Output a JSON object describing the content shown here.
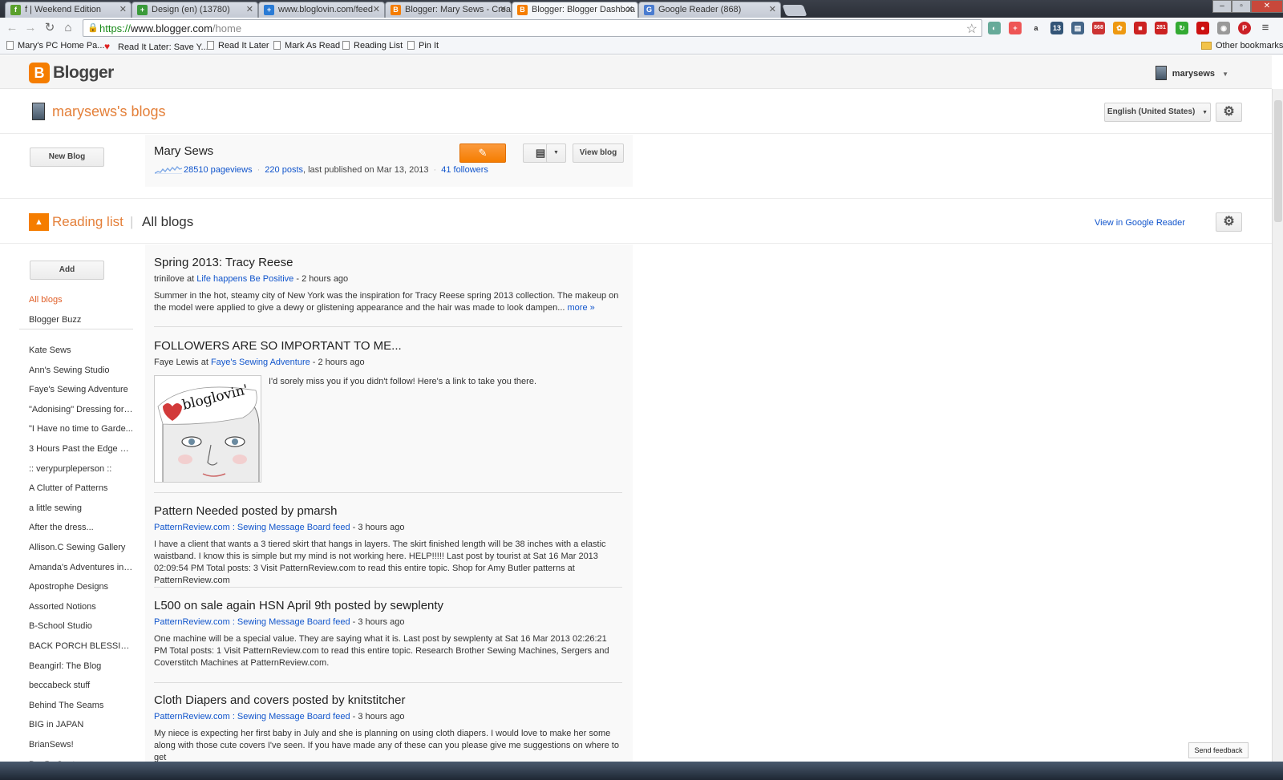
{
  "browser": {
    "tabs": [
      {
        "title": "f | Weekend Edition",
        "icon_color": "#5aa02c",
        "icon_char": "f"
      },
      {
        "title": "Design (en) (13780)",
        "icon_color": "#3a9a3a",
        "icon_char": "+"
      },
      {
        "title": "www.bloglovin.com/feed",
        "icon_color": "#2a7bd5",
        "icon_char": "+"
      },
      {
        "title": "Blogger: Mary Sews - Crea",
        "icon_color": "#f57d00",
        "icon_char": "B"
      },
      {
        "title": "Blogger: Blogger Dashboa",
        "icon_color": "#f57d00",
        "icon_char": "B"
      },
      {
        "title": "Google Reader (868)",
        "icon_color": "#4a7cd0",
        "icon_char": "G"
      }
    ],
    "url_scheme": "https://",
    "url_host": "www.blogger.com",
    "url_path": "/home",
    "bookmarks": [
      "Mary's PC Home Pa...",
      "Read It Later: Save Y...",
      "Read It Later",
      "Mark As Read",
      "Reading List",
      "Pin It"
    ],
    "other_bookmarks": "Other bookmarks",
    "extension_badges": {
      "dash": "13",
      "mail_count": "868",
      "gmail_count": "281"
    }
  },
  "header": {
    "logo_text": "Blogger",
    "username": "marysews"
  },
  "blogs_section": {
    "title": "marysews's blogs",
    "language": "English (United States)",
    "new_blog_label": "New Blog",
    "blog": {
      "name": "Mary Sews",
      "pageviews": "28510 pageviews",
      "posts": "220 posts",
      "published": ", last published on Mar 13, 2013",
      "followers": "41 followers",
      "view_blog_label": "View blog"
    }
  },
  "reading_list": {
    "title": "Reading list",
    "subtitle": "All blogs",
    "view_in_reader": "View in Google Reader",
    "add_label": "Add",
    "filters": [
      "All blogs",
      "Blogger Buzz"
    ],
    "blogs": [
      "Kate Sews",
      "Ann's Sewing Studio",
      "Faye's Sewing Adventure",
      "\"Adonising\" Dressing for ...",
      "\"I Have no time to Garde...",
      "3 Hours Past the Edge of...",
      ":: verypurpleperson ::",
      "A Clutter of Patterns",
      "a little sewing",
      "After the dress...",
      "Allison.C Sewing Gallery",
      "Amanda's Adventures in ...",
      "Apostrophe Designs",
      "Assorted Notions",
      "B-School Studio",
      "BACK PORCH BLESSIN...",
      "Beangirl: The Blog",
      "beccabeck stuff",
      "Behind The Seams",
      "BIG in JAPAN",
      "BrianSews!",
      "Byrdie Couture"
    ]
  },
  "posts": [
    {
      "title": "Spring 2013: Tracy Reese",
      "author": "trinilove",
      "at": " at ",
      "source": "Life happens Be Positive",
      "time": " - 2 hours ago",
      "body": "Summer in the hot, steamy city of New York was the inspiration for Tracy Reese spring 2013 collection. The makeup on the model were applied to give a dewy or glistening appearance and the hair was made to look dampen...",
      "more": "more »"
    },
    {
      "title": "FOLLOWERS ARE SO IMPORTANT TO ME...",
      "author": "Faye Lewis",
      "at": " at ",
      "source": "Faye's Sewing Adventure",
      "time": " - 2 hours ago",
      "body": "I'd sorely miss you if you didn't follow! Here's a link to take you there.",
      "image_text": "bloglovin'"
    },
    {
      "title": "Pattern Needed posted by pmarsh",
      "source": "PatternReview.com : Sewing Message Board feed",
      "time": " - 3 hours ago",
      "body": "I have a client that wants a 3 tiered skirt that hangs in layers. The skirt finished length will be 38 inches with a elastic waistband. I know this is simple but my mind is not working here. HELP!!!!! Last post by tourist at Sat 16 Mar 2013 02:09:54 PM Total posts: 3 Visit PatternReview.com to read this entire topic. Shop for Amy Butler patterns at PatternReview.com"
    },
    {
      "title": "L500 on sale again HSN April 9th posted by sewplenty",
      "source": "PatternReview.com : Sewing Message Board feed",
      "time": " - 3 hours ago",
      "body": "One machine will be a special value. They are saying what it is. Last post by sewplenty at Sat 16 Mar 2013 02:26:21 PM Total posts: 1 Visit PatternReview.com to read this entire topic. Research Brother Sewing Machines, Sergers and Coverstitch Machines at PatternReview.com."
    },
    {
      "title": "Cloth Diapers and covers posted by knitstitcher",
      "source": "PatternReview.com : Sewing Message Board feed",
      "time": " - 3 hours ago",
      "body": "My niece is expecting her first baby in July and she is planning on using cloth diapers. I would love to make her some along with those cute covers I've seen. If you have made any of these can you please give me suggestions on where to get"
    }
  ],
  "feedback_label": "Send feedback"
}
